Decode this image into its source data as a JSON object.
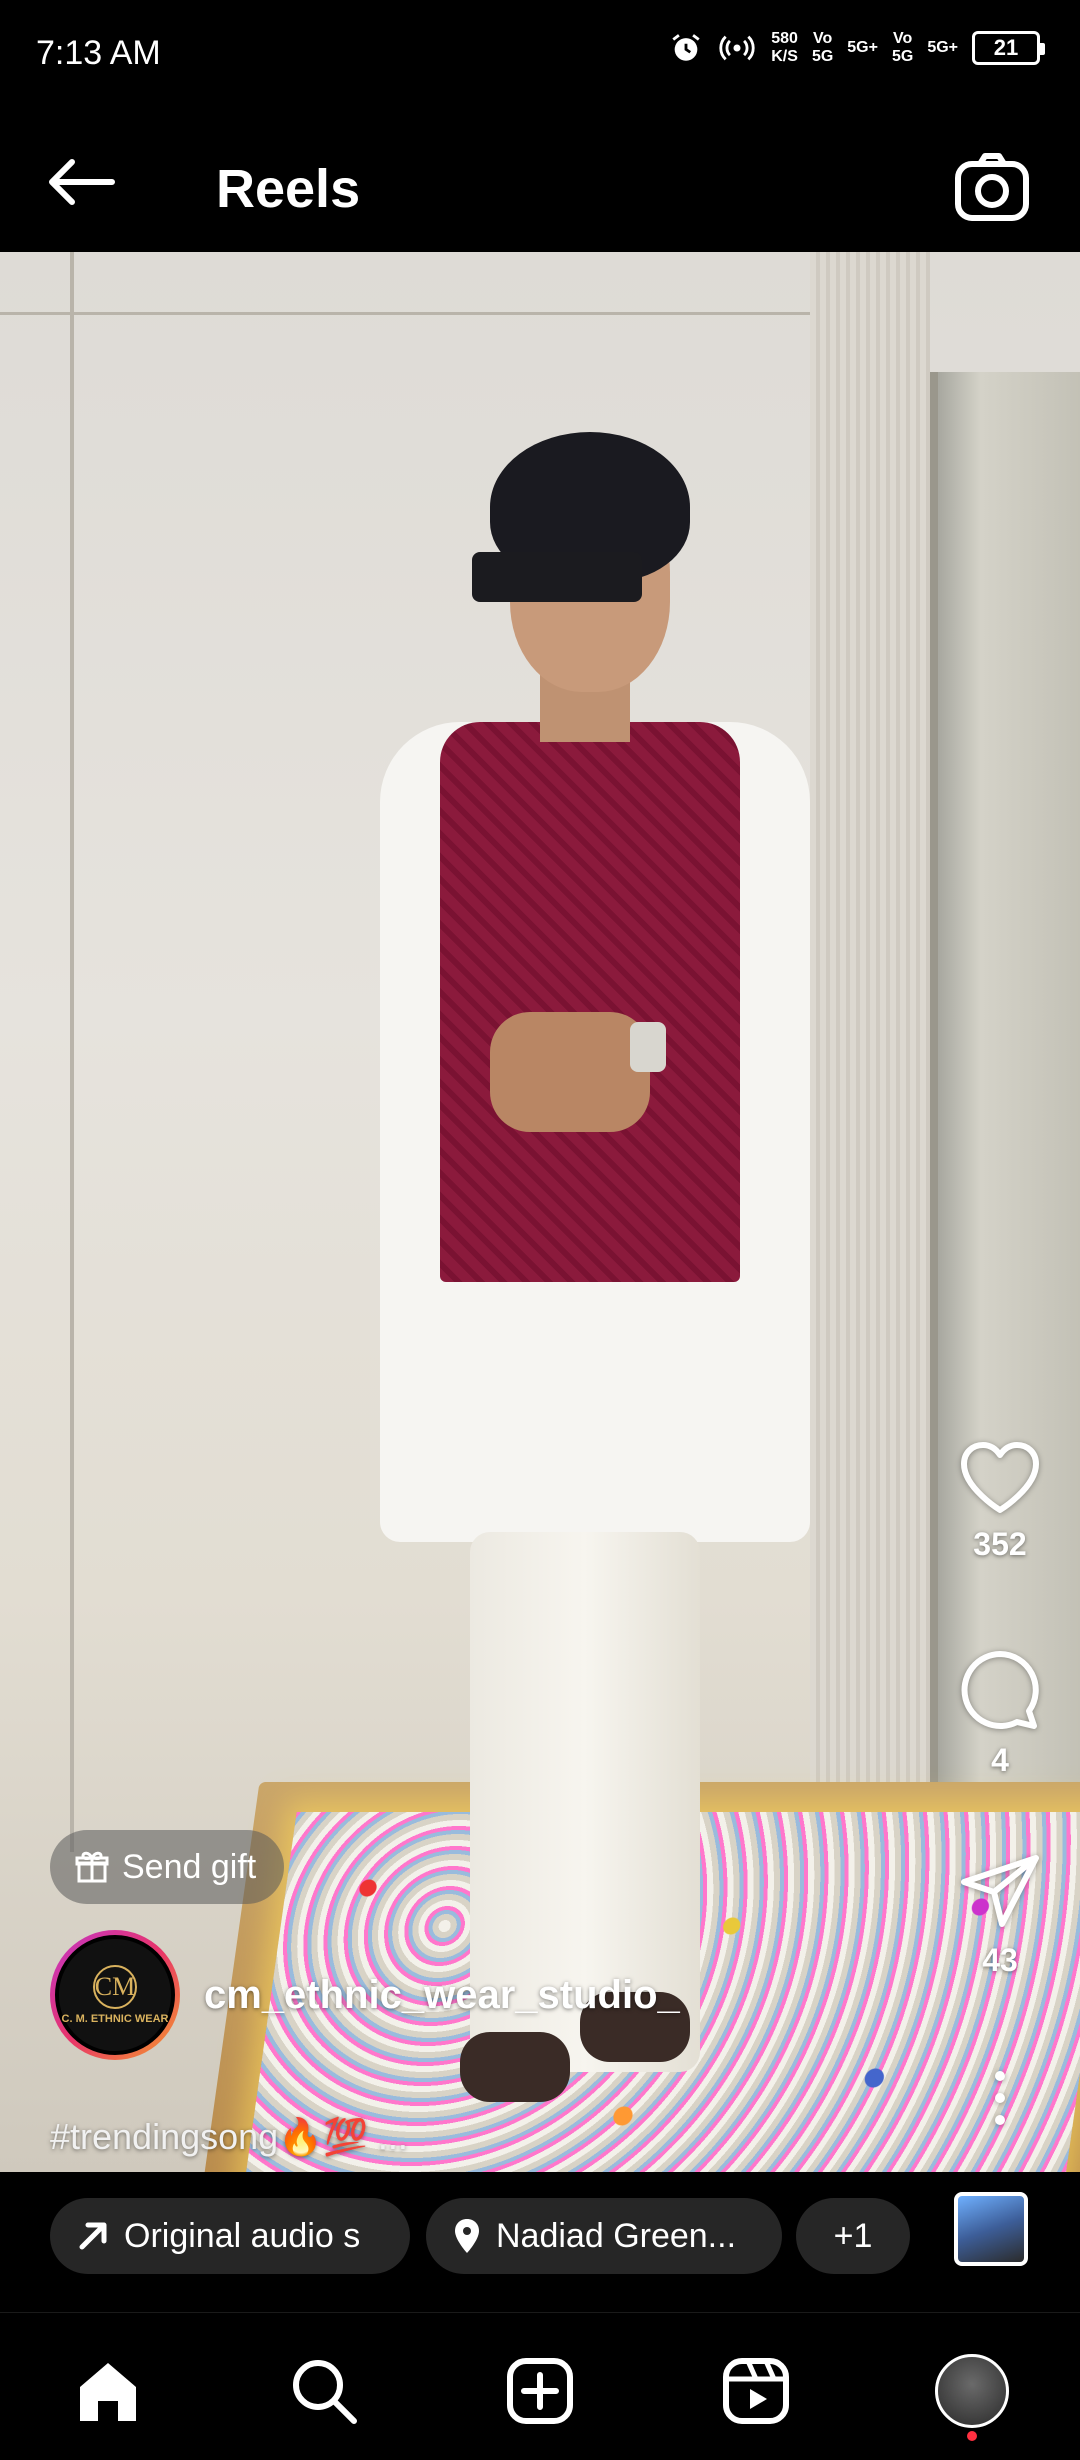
{
  "status_bar": {
    "time": "7:13 AM",
    "net_speed_top": "580",
    "net_speed_bottom": "K/S",
    "sim1_top": "Vo",
    "sim1_bottom": "5G",
    "sim1_signal": "5G+",
    "sim2_top": "Vo",
    "sim2_bottom": "5G",
    "sim2_signal": "5G+",
    "battery": "21"
  },
  "header": {
    "title": "Reels",
    "back_icon": "arrow-left-icon",
    "camera_icon": "camera-icon"
  },
  "actions": {
    "likes": "352",
    "comments": "4",
    "shares": "43"
  },
  "post": {
    "send_gift_label": "Send gift",
    "username": "cm_ethnic_wear_studio_",
    "avatar_monogram": "CM",
    "avatar_brand": "C. M. ETHNIC WEAR",
    "caption": "#trendingsong🔥💯 ..."
  },
  "chips": {
    "audio": "Original audio   s",
    "location": "Nadiad Green...",
    "more": "+1"
  },
  "bottom_nav": {
    "items": [
      "home-icon",
      "search-icon",
      "create-icon",
      "reels-icon",
      "profile-avatar"
    ]
  },
  "colors": {
    "background": "#000000",
    "accent_notification": "#ff3040",
    "vest": "#8b1a3c"
  }
}
